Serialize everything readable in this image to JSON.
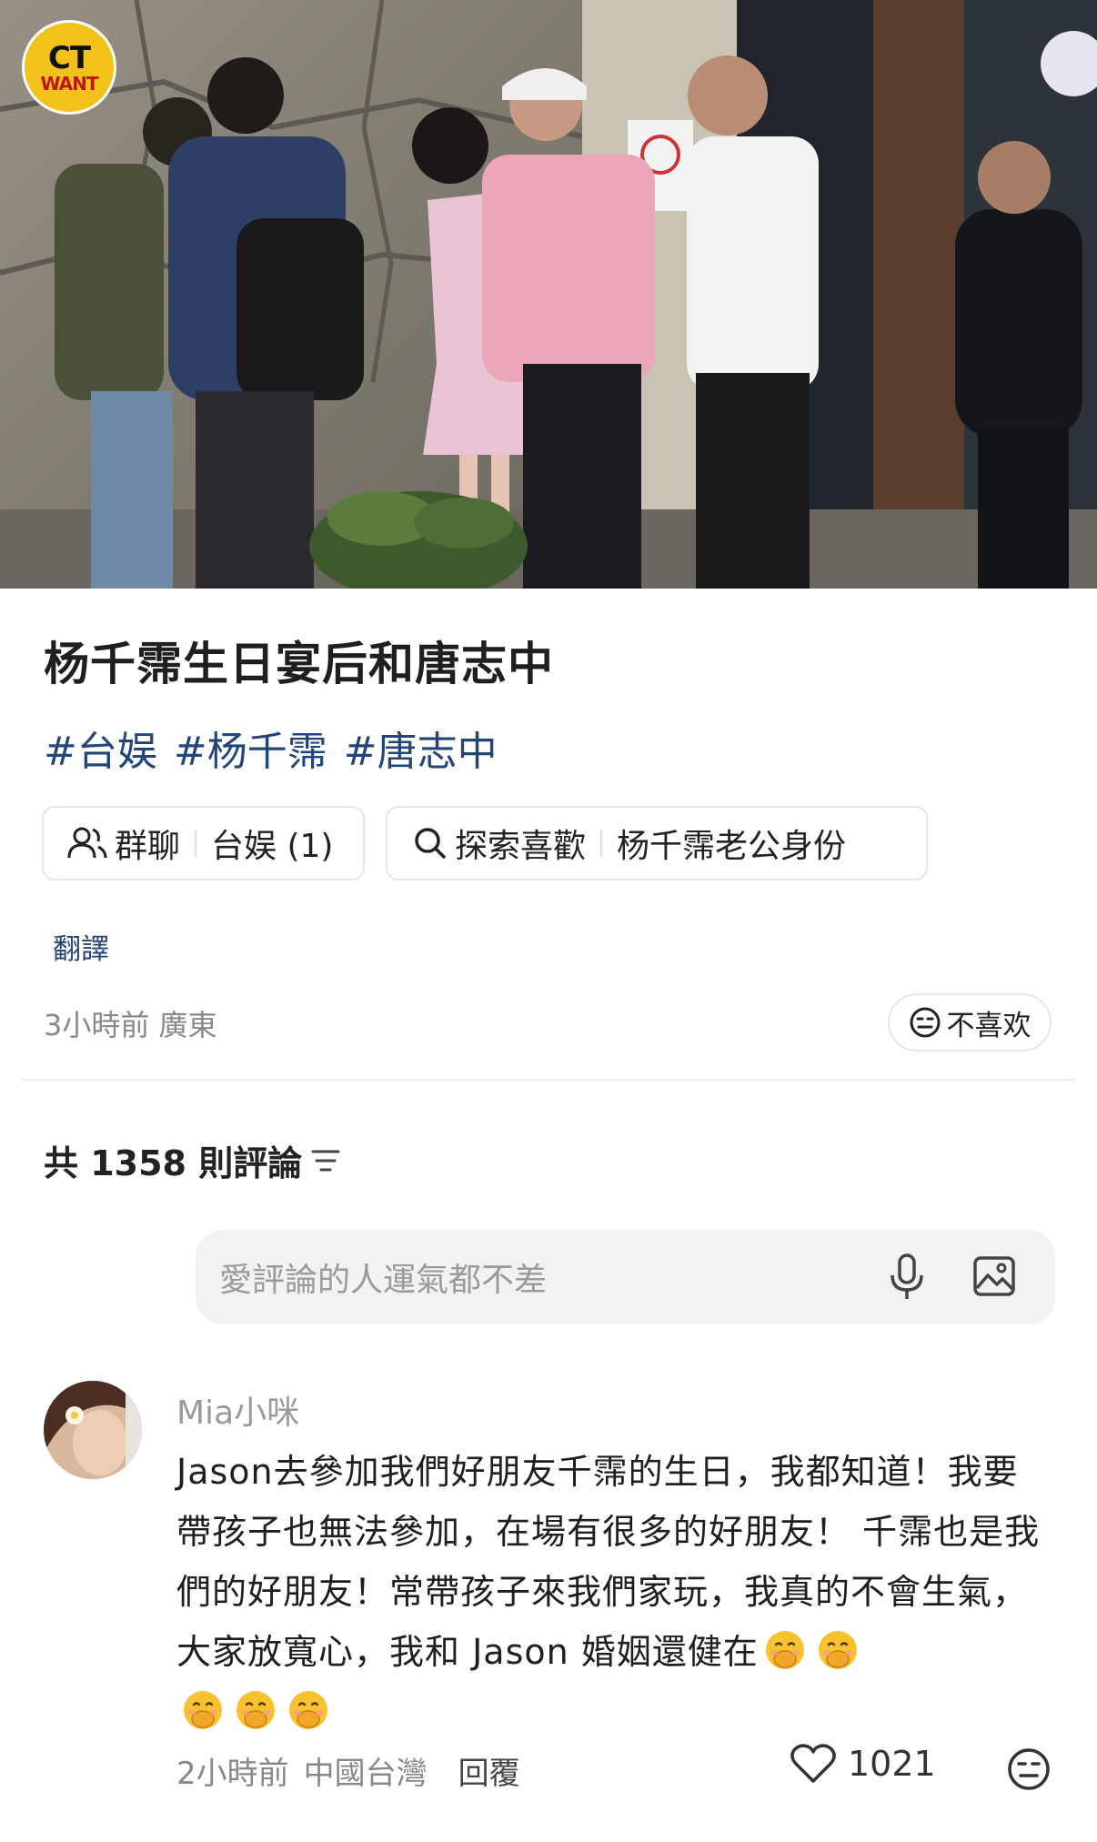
{
  "post": {
    "logo_top": "CT",
    "logo_bottom": "WANT",
    "title": "杨千霈生日宴后和唐志中",
    "tags": [
      "#台娱",
      "#杨千霈",
      "#唐志中"
    ],
    "chip_group": {
      "label": "群聊",
      "value": "台娱 (1)"
    },
    "chip_explore": {
      "label": "探索喜歡",
      "value": "杨千霈老公身份"
    },
    "translate_label": "翻譯",
    "meta": "3小時前 廣東",
    "dislike_label": "不喜欢"
  },
  "comments_header": {
    "count_label": "共 1358 則評論"
  },
  "comment_input": {
    "placeholder": "愛評論的人運氣都不差"
  },
  "comment": {
    "author": "Mia小咪",
    "text": "Jason去參加我們好朋友千霈的生日，我都知道！我要帶孩子也無法參加，在場有很多的好朋友！ 千霈也是我們的好朋友！常帶孩子來我們家玩，我真的不會生氣，大家放寬心，我和 Jason 婚姻還健在",
    "emoji_count": 5,
    "time": "2小時前",
    "location": "中國台灣",
    "reply_label": "回覆",
    "likes": "1021"
  },
  "colors": {
    "tag_blue": "#22457a",
    "logo_yellow": "#f3c21a",
    "logo_red": "#c0141b"
  }
}
